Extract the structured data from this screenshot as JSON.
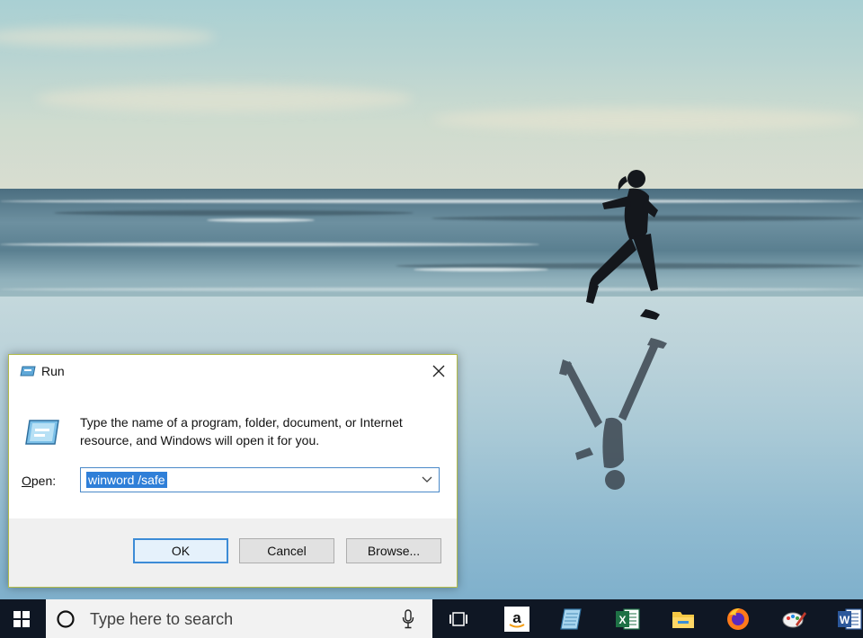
{
  "dialog": {
    "title": "Run",
    "description": "Type the name of a program, folder, document, or Internet resource, and Windows will open it for you.",
    "open_label": "Open:",
    "open_value": "winword /safe",
    "buttons": {
      "ok": "OK",
      "cancel": "Cancel",
      "browse": "Browse..."
    }
  },
  "taskbar": {
    "search_placeholder": "Type here to search",
    "pinned_apps": [
      "task-view",
      "amazon",
      "notepad",
      "excel",
      "file-explorer",
      "firefox",
      "paint",
      "word"
    ]
  },
  "colors": {
    "taskbar": "#0f1724",
    "accent": "#3c8bd6",
    "selection": "#2f7fd8",
    "dialog_border": "#b3bc4a"
  }
}
